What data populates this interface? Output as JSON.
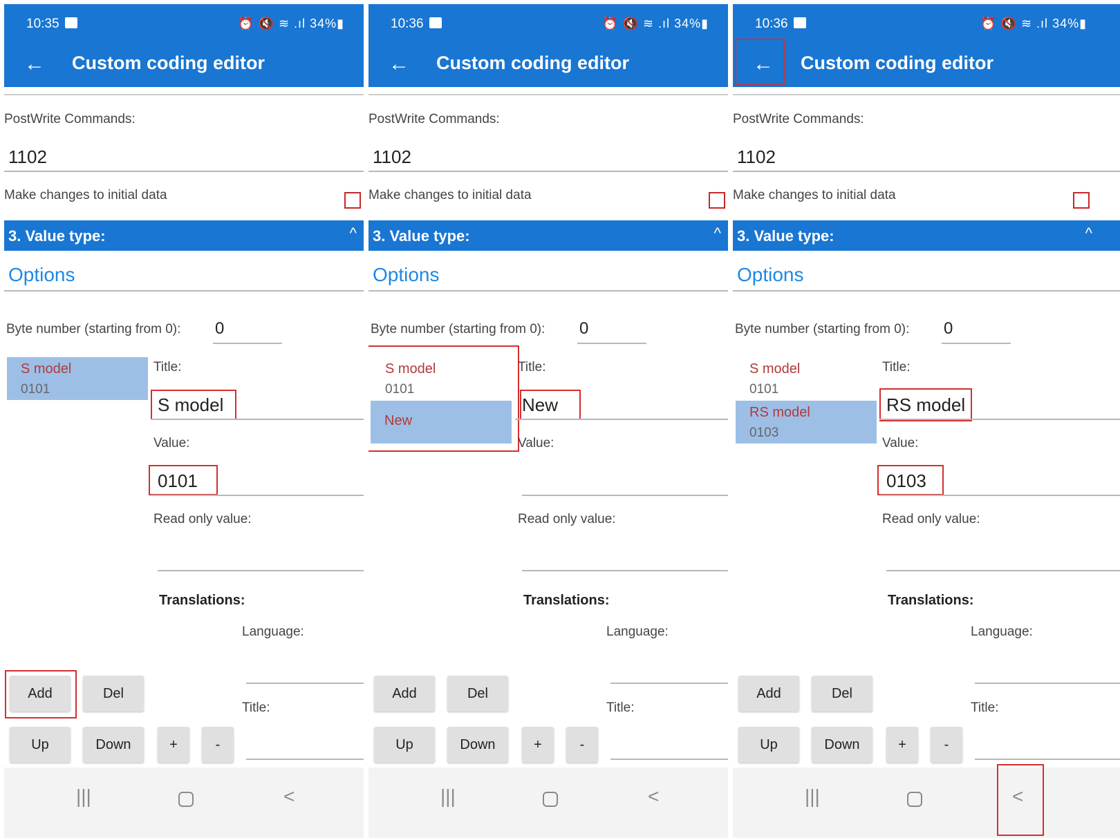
{
  "colors": {
    "accent": "#1976d2",
    "highlight": "#d32f2f",
    "selected_item_bg": "#9dbfe6",
    "list_title": "#b23a3a",
    "options_link": "#1e88e5"
  },
  "icons": {
    "back": "arrow-left-icon",
    "collapse": "chevron-up-icon",
    "recents": "recent-apps-icon",
    "home": "home-icon",
    "nav_back": "nav-back-icon"
  },
  "screens": [
    {
      "status": {
        "time": "10:35",
        "right": "34%"
      },
      "app_bar": {
        "back_glyph": "←",
        "title": "Custom coding editor"
      },
      "postwrite": {
        "label": "PostWrite Commands:",
        "value": "1102"
      },
      "make_changes_label": "Make changes to initial data",
      "make_changes_checked": false,
      "section": {
        "title": "3. Value type:",
        "caret": "^"
      },
      "options_tab": "Options",
      "byte_number": {
        "label": "Byte number (starting from 0):",
        "value": "0"
      },
      "items": [
        {
          "name": "S model",
          "value": "0101",
          "selected": true
        }
      ],
      "details": {
        "title_label": "Title:",
        "title_value": "S model",
        "value_label": "Value:",
        "value_value": "0101",
        "readonly_label": "Read only value:",
        "readonly_value": ""
      },
      "translations": {
        "heading": "Translations:",
        "language_label": "Language:",
        "title_label": "Title:"
      },
      "buttons": {
        "add": "Add",
        "del": "Del",
        "up": "Up",
        "down": "Down",
        "plus": "+",
        "minus": "-"
      },
      "nav": {
        "recents": "|||",
        "back": "<"
      }
    },
    {
      "status": {
        "time": "10:36",
        "right": "34%"
      },
      "app_bar": {
        "back_glyph": "←",
        "title": "Custom coding editor"
      },
      "postwrite": {
        "label": "PostWrite Commands:",
        "value": "1102"
      },
      "make_changes_label": "Make changes to initial data",
      "make_changes_checked": false,
      "section": {
        "title": "3. Value type:",
        "caret": "^"
      },
      "options_tab": "Options",
      "byte_number": {
        "label": "Byte number (starting from 0):",
        "value": "0"
      },
      "items": [
        {
          "name": "S model",
          "value": "0101",
          "selected": false
        },
        {
          "name": "New",
          "value": "",
          "selected": true
        }
      ],
      "details": {
        "title_label": "Title:",
        "title_value": "New",
        "value_label": "Value:",
        "value_value": "",
        "readonly_label": "Read only value:",
        "readonly_value": ""
      },
      "translations": {
        "heading": "Translations:",
        "language_label": "Language:",
        "title_label": "Title:"
      },
      "buttons": {
        "add": "Add",
        "del": "Del",
        "up": "Up",
        "down": "Down",
        "plus": "+",
        "minus": "-"
      },
      "nav": {
        "recents": "|||",
        "back": "<"
      }
    },
    {
      "status": {
        "time": "10:36",
        "right": "34%"
      },
      "app_bar": {
        "back_glyph": "←",
        "title": "Custom coding editor"
      },
      "postwrite": {
        "label": "PostWrite Commands:",
        "value": "1102"
      },
      "make_changes_label": "Make changes to initial data",
      "make_changes_checked": false,
      "section": {
        "title": "3. Value type:",
        "caret": "^"
      },
      "options_tab": "Options",
      "byte_number": {
        "label": "Byte number (starting from 0):",
        "value": "0"
      },
      "items": [
        {
          "name": "S model",
          "value": "0101",
          "selected": false
        },
        {
          "name": "RS model",
          "value": "0103",
          "selected": true
        }
      ],
      "details": {
        "title_label": "Title:",
        "title_value": "RS model",
        "value_label": "Value:",
        "value_value": "0103",
        "readonly_label": "Read only value:",
        "readonly_value": ""
      },
      "translations": {
        "heading": "Translations:",
        "language_label": "Language:",
        "title_label": "Title:"
      },
      "buttons": {
        "add": "Add",
        "del": "Del",
        "up": "Up",
        "down": "Down",
        "plus": "+",
        "minus": "-"
      },
      "nav": {
        "recents": "|||",
        "back": "<"
      }
    }
  ]
}
